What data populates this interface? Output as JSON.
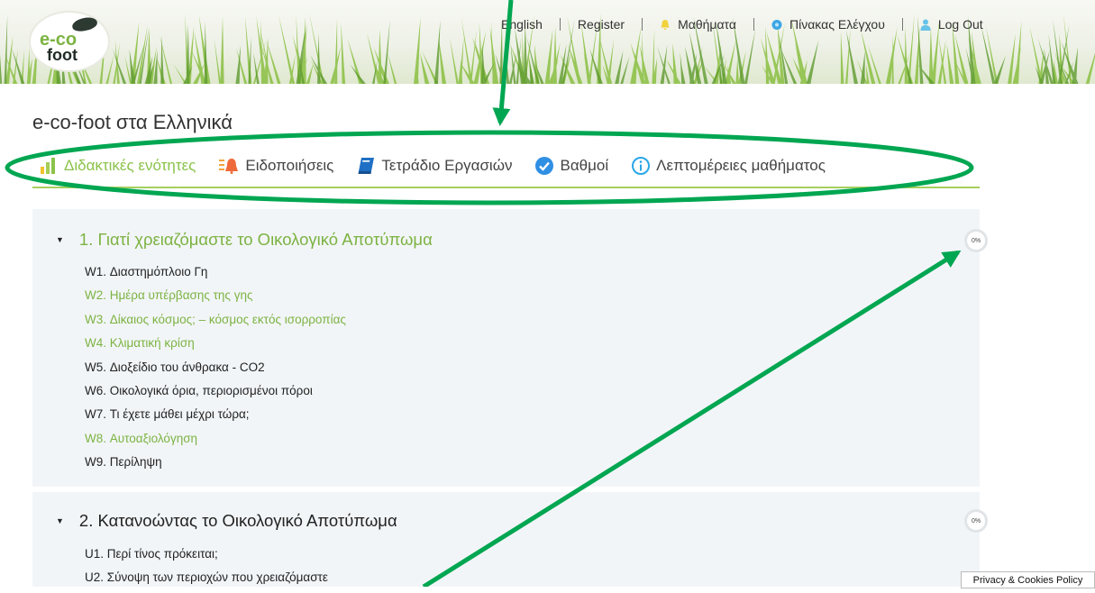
{
  "header": {
    "logo_line1": "e-co",
    "logo_line2": "foot",
    "nav": [
      {
        "label": "English",
        "icon": ""
      },
      {
        "label": "Register",
        "icon": ""
      },
      {
        "label": "Μαθήματα",
        "icon": "bell-icon"
      },
      {
        "label": "Πίνακας Ελέγχου",
        "icon": "dashboard-icon"
      },
      {
        "label": "Log Out",
        "icon": "user-icon"
      }
    ]
  },
  "page_title": "e-co-foot στα Ελληνικά",
  "tabs": [
    {
      "label": "Διδακτικές ενότητες",
      "icon": "bar-chart-icon",
      "active": true
    },
    {
      "label": "Ειδοποιήσεις",
      "icon": "megaphone-icon",
      "active": false
    },
    {
      "label": "Τετράδιο Εργασιών",
      "icon": "book-icon",
      "active": false
    },
    {
      "label": "Βαθμοί",
      "icon": "check-circle-icon",
      "active": false
    },
    {
      "label": "Λεπτομέρειες μαθήματος",
      "icon": "info-icon",
      "active": false
    }
  ],
  "sections": [
    {
      "title": "1. Γιατί χρειαζόμαστε το Οικολογικό Αποτύπωμα",
      "progress": "0%",
      "items": [
        {
          "label": "W1. Διαστημόπλοιο Γη",
          "link": false
        },
        {
          "label": "W2. Ημέρα υπέρβασης της γης",
          "link": true
        },
        {
          "label": "W3. Δίκαιος κόσμος; – κόσμος εκτός ισορροπίας",
          "link": true
        },
        {
          "label": "W4. Κλιματική κρίση",
          "link": true
        },
        {
          "label": "W5. Διοξείδιο του άνθρακα - CO2",
          "link": false
        },
        {
          "label": "W6. Οικολογικά όρια, περιορισμένοι πόροι",
          "link": false
        },
        {
          "label": "W7. Τι έχετε μάθει μέχρι τώρα;",
          "link": false
        },
        {
          "label": "W8. Αυτοαξιολόγηση",
          "link": true
        },
        {
          "label": "W9. Περίληψη",
          "link": false
        }
      ]
    },
    {
      "title": "2. Κατανοώντας το Οικολογικό Αποτύπωμα",
      "progress": "0%",
      "items": [
        {
          "label": "U1. Περί τίνος πρόκειται;",
          "link": false
        },
        {
          "label": "U2. Σύνοψη των περιοχών που χρειαζόμαστε",
          "link": false
        }
      ]
    }
  ],
  "privacy_label": "Privacy & Cookies Policy",
  "colors": {
    "accent_green": "#8bc34a",
    "annotation_green": "#00a651",
    "section_bg": "#f2f5f8"
  }
}
